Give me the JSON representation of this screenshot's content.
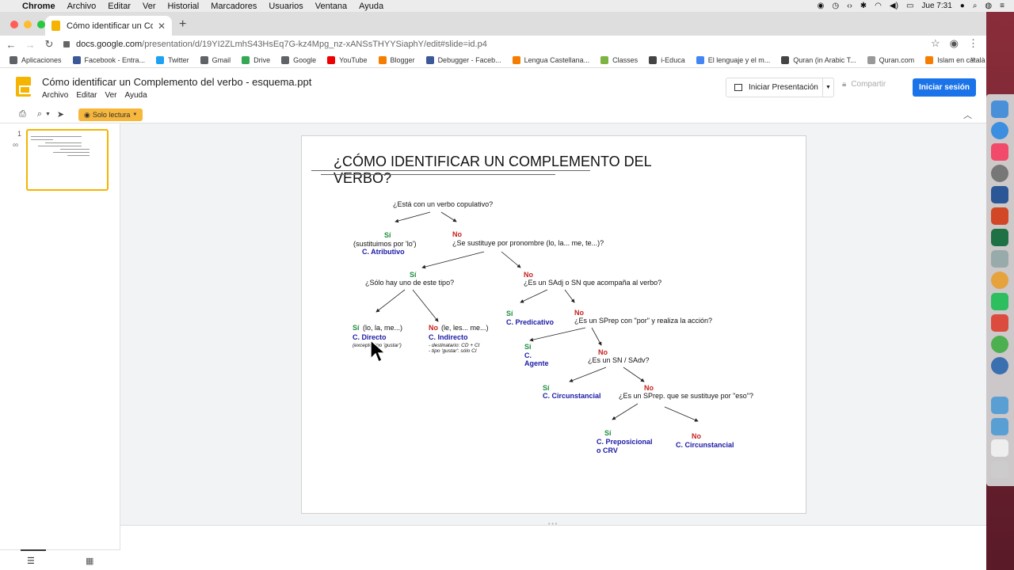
{
  "menubar": {
    "app": "Chrome",
    "items": [
      "Archivo",
      "Editar",
      "Ver",
      "Historial",
      "Marcadores",
      "Usuarios",
      "Ventana",
      "Ayuda"
    ],
    "clock": "Jue 7:31"
  },
  "browser": {
    "tab_title": "Cómo identificar un Compleme",
    "url_host": "docs.google.com",
    "url_path": "/presentation/d/19YI2ZLmhS43HsEq7G-kz4Mpg_nz-xANSsTHYYSiaphY/edit#slide=id.p4",
    "bookmarks": [
      {
        "label": "Aplicaciones",
        "color": "#5f6368"
      },
      {
        "label": "Facebook - Entra...",
        "color": "#3b5998"
      },
      {
        "label": "Twitter",
        "color": "#1da1f2"
      },
      {
        "label": "Gmail",
        "color": "#5f6368"
      },
      {
        "label": "Drive",
        "color": "#34a853"
      },
      {
        "label": "Google",
        "color": "#5f6368"
      },
      {
        "label": "YouTube",
        "color": "#e00"
      },
      {
        "label": "Blogger",
        "color": "#f57d00"
      },
      {
        "label": "Debugger - Faceb...",
        "color": "#3b5998"
      },
      {
        "label": "Lengua Castellana...",
        "color": "#f57d00"
      },
      {
        "label": "Classes",
        "color": "#7cb342"
      },
      {
        "label": "i-Educa",
        "color": "#444"
      },
      {
        "label": "El lenguaje y el m...",
        "color": "#4285f4"
      },
      {
        "label": "Quran (in Arabic T...",
        "color": "#444"
      },
      {
        "label": "Quran.com",
        "color": "#999"
      },
      {
        "label": "Islam en català",
        "color": "#f57d00"
      }
    ]
  },
  "doc": {
    "title": "Cómo identificar un Complemento del verbo - esquema.ppt",
    "menu": [
      "Archivo",
      "Editar",
      "Ver",
      "Ayuda"
    ],
    "present_label": "Iniciar Presentación",
    "share_label": "Compartir",
    "signin_label": "Iniciar sesión",
    "readonly_label": "Solo lectura",
    "slide_number": "1"
  },
  "slide": {
    "title": "¿CÓMO IDENTIFICAR UN COMPLEMENTO DEL VERBO?",
    "q1": "¿Está con un verbo copulativo?",
    "si": "Sí",
    "no": "No",
    "a1_note": "(sustituimos por 'lo')",
    "a1_result": "C. Atributivo",
    "q2": "¿Se sustituye por pronombre (lo, la... me, te...)?",
    "q3": "¿Sólo hay uno de este tipo?",
    "q4": "¿Es un SAdj o SN que acompaña al verbo?",
    "cd_prefix": "(lo, la, me...)",
    "cd_result": "C. Directo",
    "cd_note": "(excepto tipo 'gustar')",
    "ci_prefix": "(le, les... me...)",
    "ci_result": "C. Indirecto",
    "ci_note1": "- destinatario: CD + CI",
    "ci_note2": "- tipo 'gustar': sólo CI",
    "pred_result": "C. Predicativo",
    "q5": "¿Es un SPrep con \"por\" y realiza la acción?",
    "ag_result1": "C.",
    "ag_result2": "Agente",
    "q6": "¿Es un SN / SAdv?",
    "cc_result": "C. Circunstancial",
    "q7": "¿Es un SPrep. que se sustituye por \"eso\"?",
    "prep_result1": "C. Preposicional",
    "prep_result2": "o CRV",
    "cc2_result": "C. Circunstancial"
  }
}
